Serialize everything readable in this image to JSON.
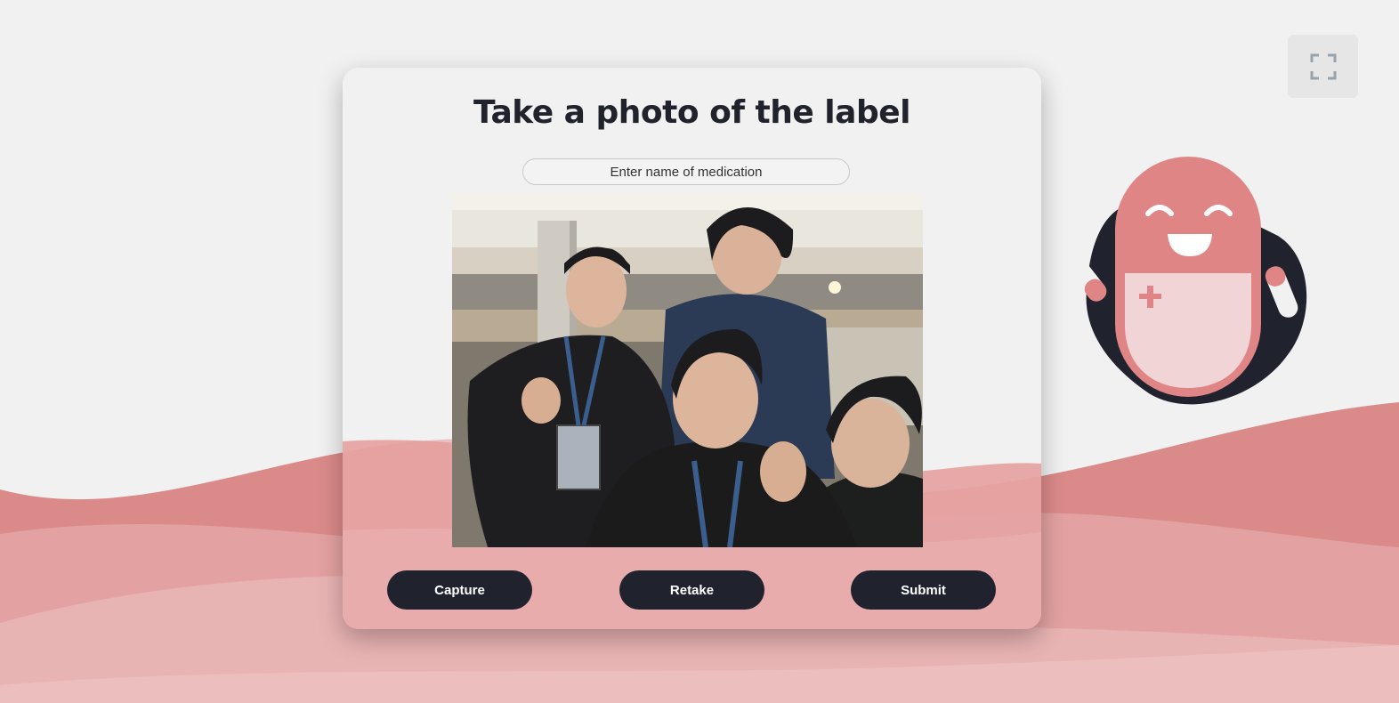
{
  "page": {
    "title": "Take a photo of the label"
  },
  "medication_input": {
    "placeholder": "Enter name of medication",
    "value": ""
  },
  "camera": {
    "content": "webcam-preview"
  },
  "actions": {
    "capture_label": "Capture",
    "retake_label": "Retake",
    "submit_label": "Submit"
  },
  "icons": {
    "fullscreen": "fullscreen-icon",
    "mascot": "pill-mascot"
  },
  "colors": {
    "background": "#f1f1f1",
    "wave_primary": "#db8a8a",
    "wave_light": "#e8b3b3",
    "button": "#20232e",
    "title": "#20232c",
    "mascot_body": "#e08585",
    "mascot_blob": "#20232e"
  }
}
